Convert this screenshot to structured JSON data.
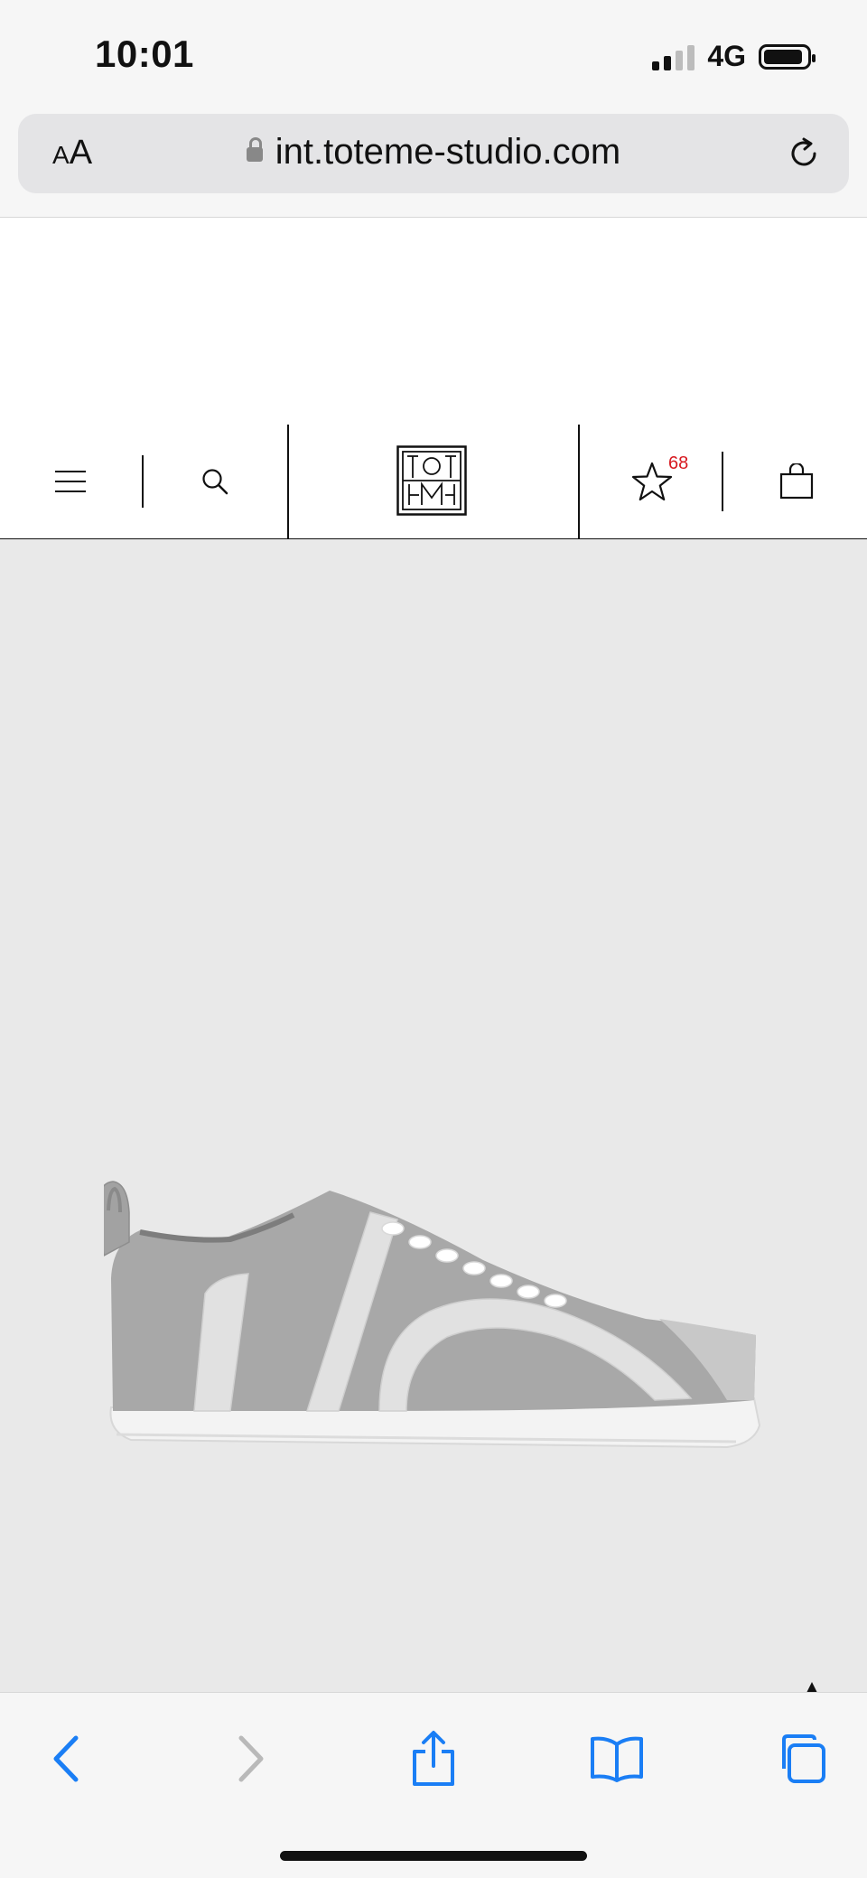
{
  "status_bar": {
    "time": "10:01",
    "network": "4G"
  },
  "browser": {
    "text_size_label_small": "A",
    "text_size_label_large": "A",
    "url": "int.toteme-studio.com"
  },
  "nav": {
    "wishlist_count": "68",
    "accent_color": "#d71920"
  },
  "product": {
    "image_icon": "sneaker-image"
  },
  "toolbar": {
    "icons": [
      "back-icon",
      "forward-icon",
      "share-icon",
      "bookmarks-icon",
      "tabs-icon"
    ]
  }
}
